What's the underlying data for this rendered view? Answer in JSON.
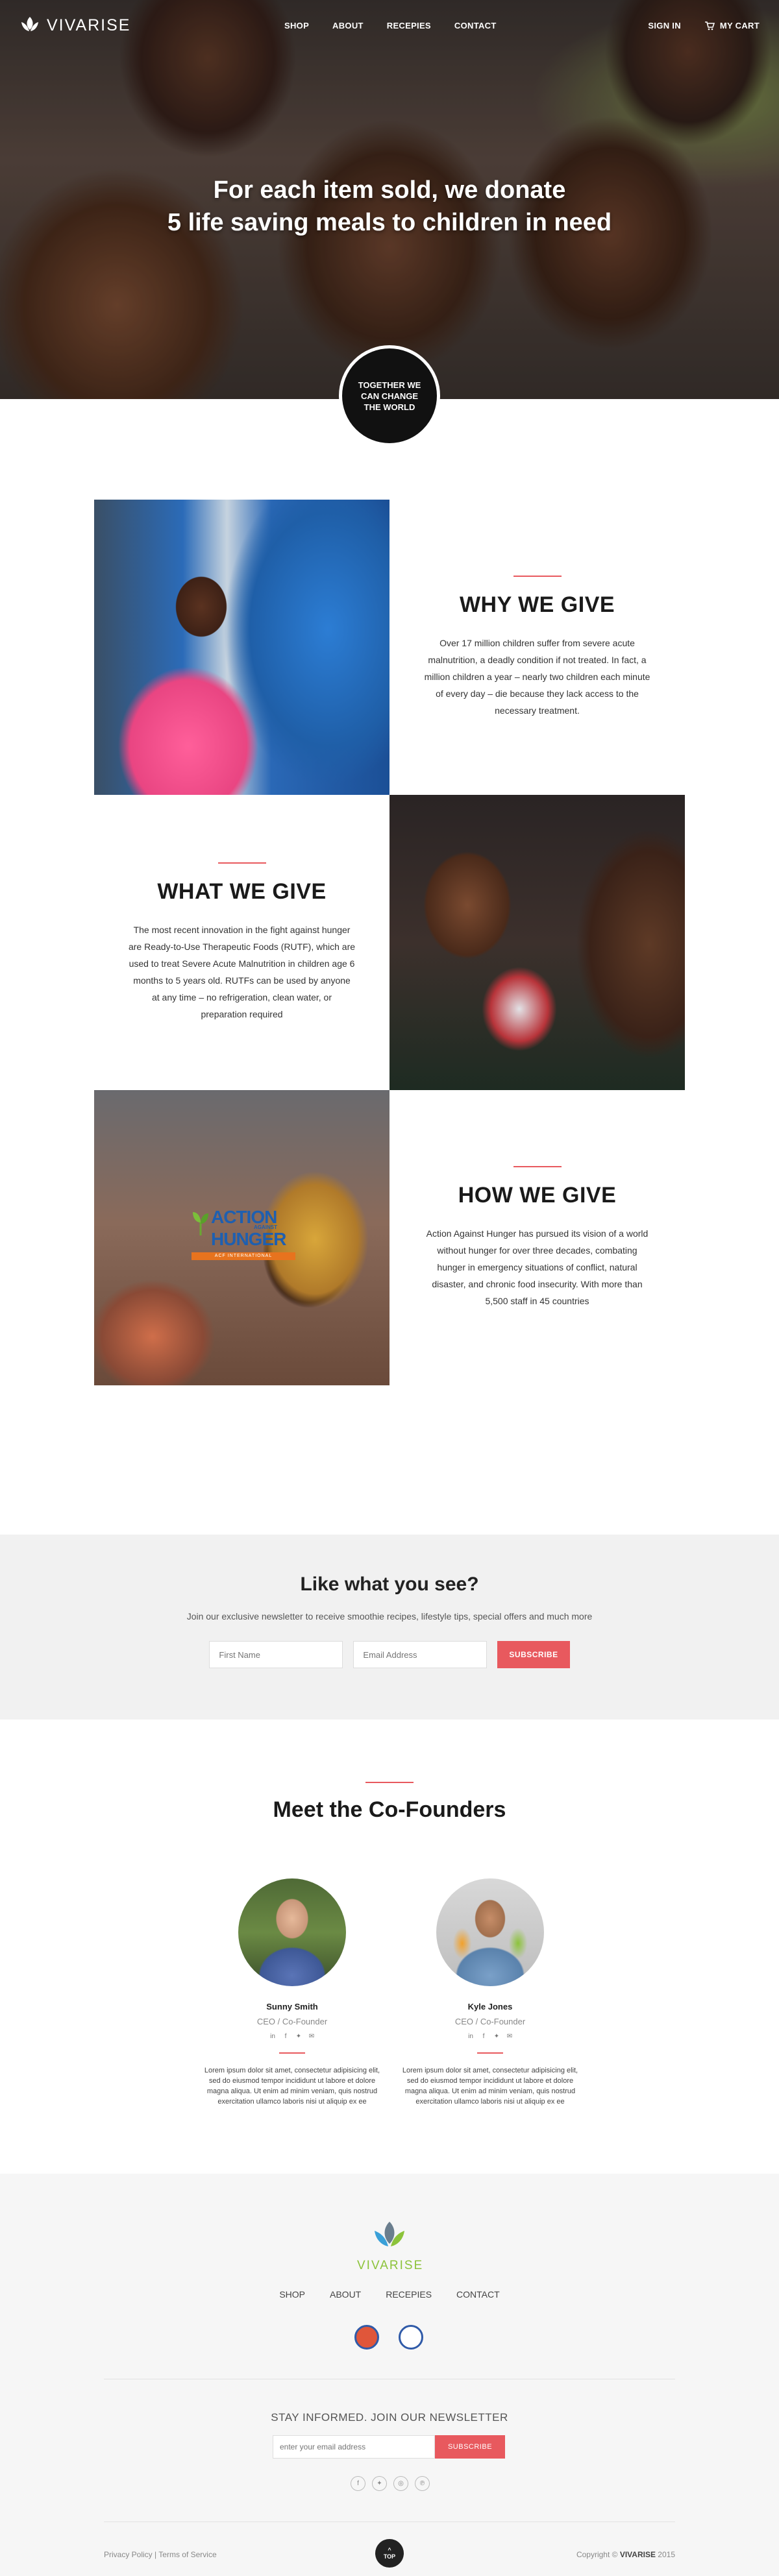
{
  "brand": {
    "name": "VIVARISE"
  },
  "nav": {
    "links": [
      "SHOP",
      "ABOUT",
      "RECEPIES",
      "CONTACT"
    ],
    "sign_in": "SIGN IN",
    "cart": "MY CART"
  },
  "hero": {
    "title_line1": "For each item sold, we donate",
    "title_line2": "5 life saving meals to children in need",
    "badge": "TOGETHER WE CAN CHANGE THE WORLD"
  },
  "why": {
    "title": "WHY WE GIVE",
    "body": "Over 17 million children suffer from severe acute malnutrition, a deadly condition if not treated.  In fact, a million children a year – nearly two children each minute of every day – die because they lack access to the necessary treatment."
  },
  "what": {
    "title": "WHAT WE GIVE",
    "body": "The most recent innovation in the fight against hunger are Ready-to-Use Therapeutic Foods (RUTF), which are used to treat Severe Acute Malnutrition in children age 6 months to 5 years old.  RUTFs can be used by anyone at any time – no refrigeration, clean water, or preparation required"
  },
  "how": {
    "title": "HOW WE GIVE",
    "body": "Action Against Hunger has pursued its vision of a world without hunger for over three decades, combating hunger in emergency situations of conflict, natural disaster, and chronic food insecurity. With more than 5,500 staff in 45 countries",
    "logo": {
      "line1": "ACTION",
      "against": "AGAINST",
      "line2": "HUNGER",
      "sub": "ACF INTERNATIONAL"
    }
  },
  "newsletter": {
    "title": "Like what you see?",
    "subtitle": "Join our exclusive newsletter to receive smoothie recipes, lifestyle tips, special offers and much more",
    "first_name_placeholder": "First Name",
    "email_placeholder": "Email Address",
    "button": "SUBSCRIBE"
  },
  "founders": {
    "title": "Meet the Co-Founders",
    "people": [
      {
        "name": "Sunny Smith",
        "role": "CEO / Co-Founder",
        "bio": "Lorem ipsum dolor sit amet, consectetur adipisicing elit, sed do eiusmod tempor incididunt ut labore et dolore magna aliqua. Ut enim ad minim veniam, quis nostrud exercitation ullamco laboris nisi ut aliquip ex ee"
      },
      {
        "name": "Kyle Jones",
        "role": "CEO / Co-Founder",
        "bio": "Lorem ipsum dolor sit amet, consectetur adipisicing elit, sed do eiusmod tempor incididunt ut labore et dolore magna aliqua. Ut enim ad minim veniam, quis nostrud exercitation ullamco laboris nisi ut aliquip ex ee"
      }
    ],
    "social_icons": [
      "linkedin-icon",
      "facebook-icon",
      "twitter-icon",
      "email-icon"
    ]
  },
  "footer": {
    "logo_text": "VIVARISE",
    "nav": [
      "SHOP",
      "ABOUT",
      "RECEPIES",
      "CONTACT"
    ],
    "newsletter_title": "STAY INFORMED. JOIN OUR NEWSLETTER",
    "email_placeholder": "enter your email address",
    "button": "SUBSCRIBE",
    "social_icons": [
      "facebook-icon",
      "twitter-icon",
      "instagram-icon",
      "pinterest-icon"
    ],
    "privacy": "Privacy Policy",
    "separator": "|",
    "terms": "Terms of Service",
    "top_label": "TOP",
    "copyright_prefix": "Copyright ©",
    "copyright_brand": "VIVARISE",
    "copyright_year": "2015"
  },
  "colors": {
    "accent": "#e8595e",
    "brand_green": "#8cc33a",
    "dark": "#1a1a1a"
  }
}
